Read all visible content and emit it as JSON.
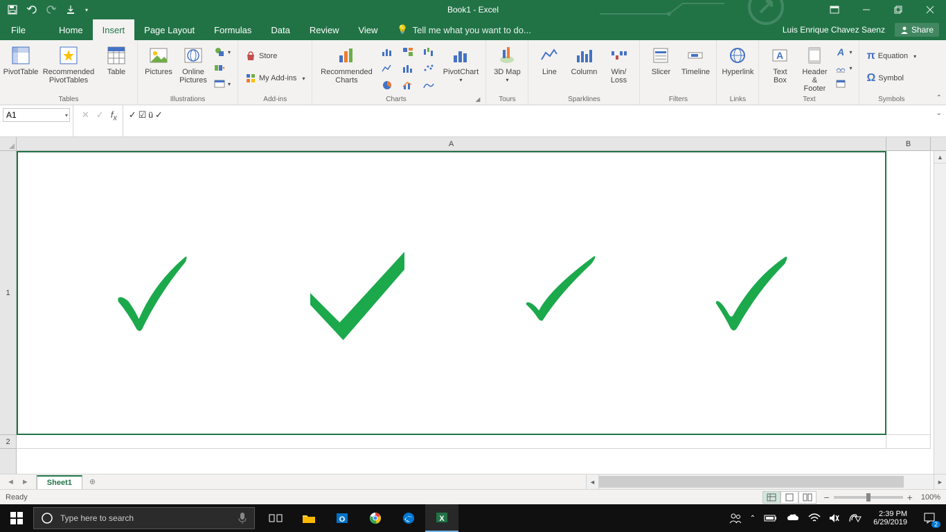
{
  "title": "Book1 - Excel",
  "qat": {
    "save": "",
    "undo": "",
    "redo": "",
    "touch": ""
  },
  "window": {
    "ribbon_opts": "",
    "min": "",
    "max": "",
    "close": ""
  },
  "tabs": {
    "file": "File",
    "home": "Home",
    "insert": "Insert",
    "pagelayout": "Page Layout",
    "formulas": "Formulas",
    "data": "Data",
    "review": "Review",
    "view": "View",
    "tellme": "Tell me what you want to do...",
    "active": "insert"
  },
  "user": "Luis Enrique Chavez Saenz",
  "share": "Share",
  "ribbon": {
    "tables": {
      "pivottable": "PivotTable",
      "recommended": "Recommended PivotTables",
      "table": "Table",
      "label": "Tables"
    },
    "illustrations": {
      "pictures": "Pictures",
      "online": "Online Pictures",
      "shapes": "",
      "smartart": "",
      "screenshot": "",
      "label": "Illustrations"
    },
    "addins": {
      "store": "Store",
      "myaddins": "My Add-ins",
      "label": "Add-ins"
    },
    "charts": {
      "recommended": "Recommended Charts",
      "pivotchart": "PivotChart",
      "label": "Charts"
    },
    "tours": {
      "map3d": "3D Map",
      "label": "Tours"
    },
    "sparklines": {
      "line": "Line",
      "column": "Column",
      "winloss": "Win/ Loss",
      "label": "Sparklines"
    },
    "filters": {
      "slicer": "Slicer",
      "timeline": "Timeline",
      "label": "Filters"
    },
    "links": {
      "hyperlink": "Hyperlink",
      "label": "Links"
    },
    "text": {
      "textbox": "Text Box",
      "headerfooter": "Header & Footer",
      "wordart": "",
      "sigline": "",
      "object": "",
      "label": "Text"
    },
    "symbols": {
      "equation": "Equation",
      "symbol": "Symbol",
      "label": "Symbols"
    }
  },
  "formula_bar": {
    "namebox": "A1",
    "cancel": "✕",
    "enter": "✓",
    "fx": "fx",
    "value": "✓ ☑ ü ✓"
  },
  "grid": {
    "colA": "A",
    "colB": "B",
    "row1": "1",
    "row2": "2",
    "cell_content_desc": "four green checkmarks"
  },
  "sheet": {
    "name": "Sheet1",
    "add": "+"
  },
  "status": {
    "ready": "Ready",
    "zoom": "100%"
  },
  "taskbar": {
    "search_placeholder": "Type here to search",
    "time": "2:39 PM",
    "date": "6/29/2019",
    "notif_count": "2"
  }
}
